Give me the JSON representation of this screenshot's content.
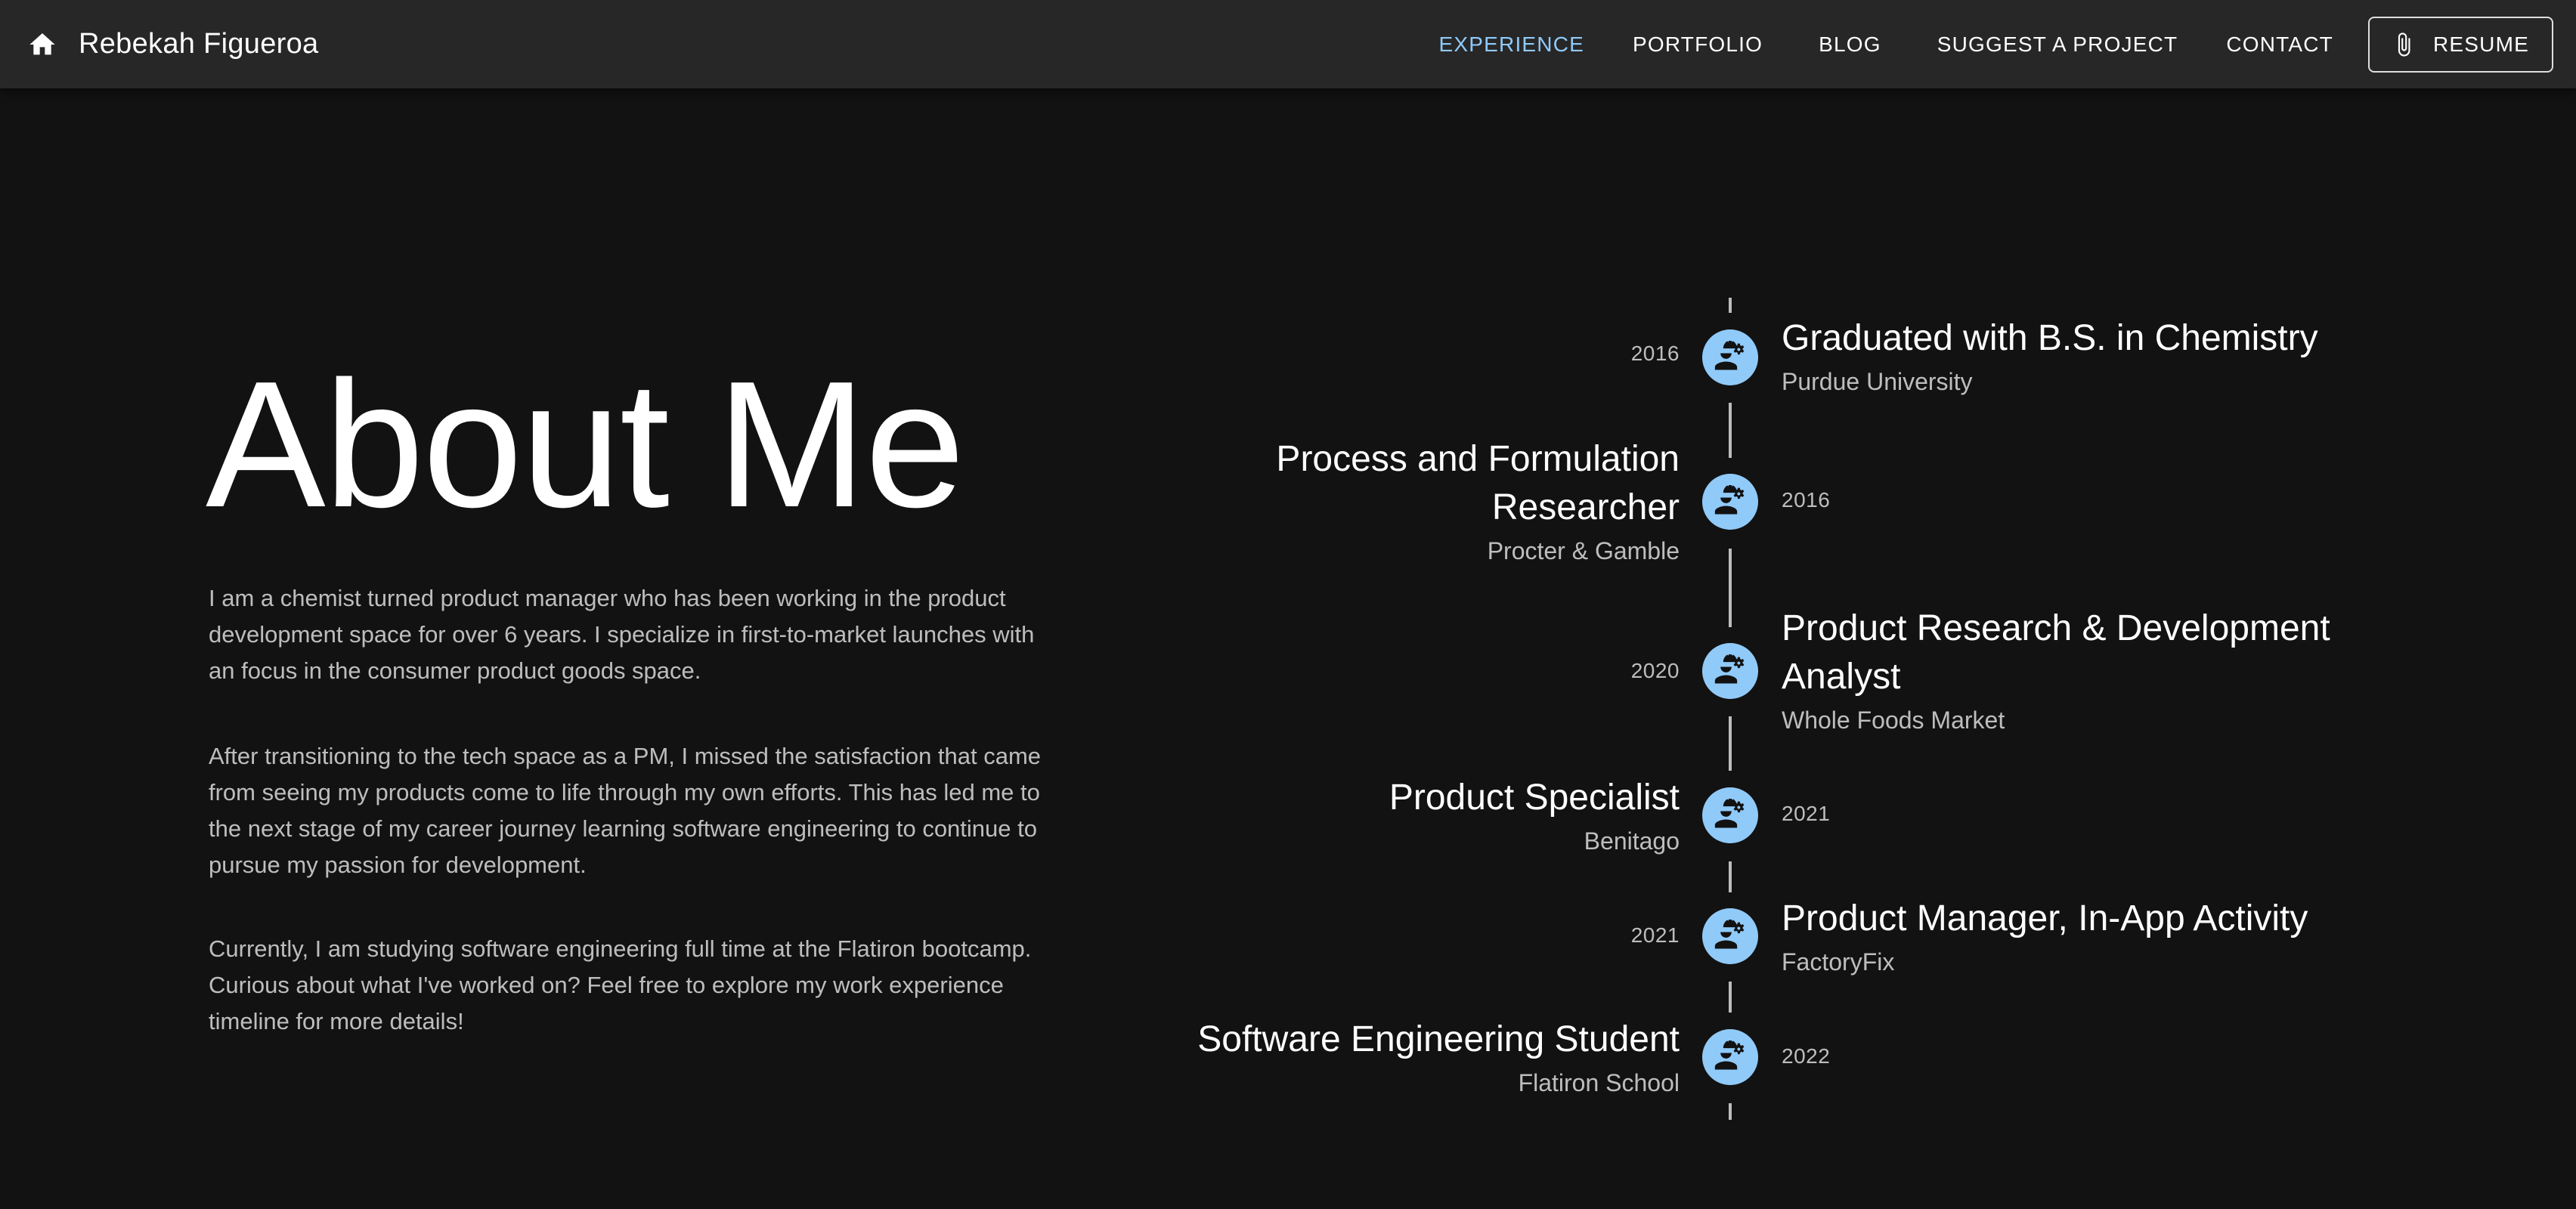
{
  "header": {
    "brand": "Rebekah Figueroa",
    "nav": [
      "EXPERIENCE",
      "PORTFOLIO",
      "BLOG",
      "SUGGEST A PROJECT",
      "CONTACT"
    ],
    "resume_label": "RESUME",
    "accent_color": "#90caf9"
  },
  "about": {
    "title": "About Me",
    "paragraphs": [
      "I am a chemist turned product manager who has been working in the product development space for over 6 years. I specialize in first-to-market launches with an focus in the consumer product goods space.",
      "After transitioning to the tech space as a PM, I missed the satisfaction that came from seeing my products come to life through my own efforts. This has led me to the next stage of my career journey learning software engineering to continue to pursue my passion for development.",
      "Currently, I am studying software engineering full time at the Flatiron bootcamp. Curious about what I've worked on? Feel free to explore my work experience timeline for more details!"
    ]
  },
  "timeline": [
    {
      "year": "2016",
      "title": "Graduated with B.S. in Chemistry",
      "org": "Purdue University",
      "icon": "engineer-icon"
    },
    {
      "year": "2016",
      "title": "Process and Formulation Researcher",
      "org": "Procter & Gamble",
      "icon": "engineer-icon"
    },
    {
      "year": "2020",
      "title": "Product Research & Development Analyst",
      "org": "Whole Foods Market",
      "icon": "engineer-icon"
    },
    {
      "year": "2021",
      "title": "Product Specialist",
      "org": "Benitago",
      "icon": "engineer-icon"
    },
    {
      "year": "2021",
      "title": "Product Manager, In-App Activity",
      "org": "FactoryFix",
      "icon": "engineer-icon"
    },
    {
      "year": "2022",
      "title": "Software Engineering Student",
      "org": "Flatiron School",
      "icon": "engineer-icon"
    }
  ]
}
